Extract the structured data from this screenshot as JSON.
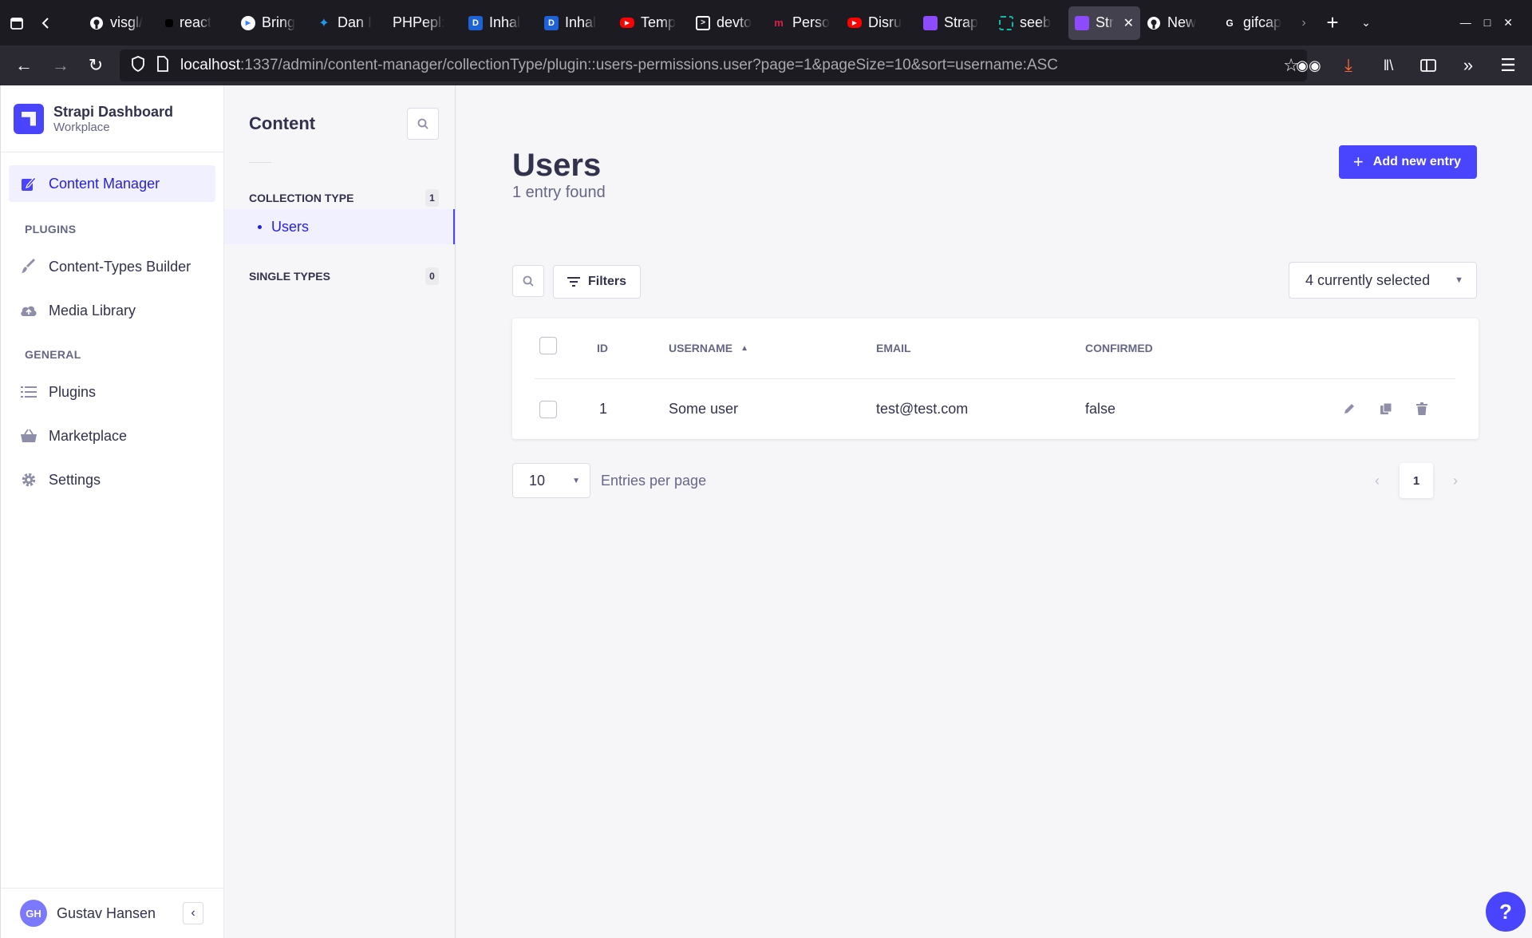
{
  "browser": {
    "tabs": [
      {
        "label": "",
        "color": "#1c1b22"
      },
      {
        "label": "visgl/",
        "color": "#fbfbfe"
      },
      {
        "label": "react",
        "color": "#111111"
      },
      {
        "label": "Bring",
        "color": "#3b82f6"
      },
      {
        "label": "Dan I",
        "color": "#1d9bf0"
      },
      {
        "label": "PHPepl:",
        "color": "#2b2a33"
      },
      {
        "label": "Inhal",
        "color": "#1e63d6"
      },
      {
        "label": "Inhal",
        "color": "#1e63d6"
      },
      {
        "label": "Temp",
        "color": "#ff0000"
      },
      {
        "label": "devto",
        "color": "#2b2a33"
      },
      {
        "label": "Perso",
        "color": "#e11d48"
      },
      {
        "label": "Disru",
        "color": "#ff0000"
      },
      {
        "label": "Strap",
        "color": "#8c4bff"
      },
      {
        "label": "seeb",
        "color": "#14b8a6"
      },
      {
        "label": "Str",
        "color": "#8c4bff",
        "active": true
      },
      {
        "label": "New",
        "color": "#fbfbfe"
      },
      {
        "label": "gifcap",
        "color": "#e11d48"
      }
    ],
    "url_host": "localhost",
    "url_path": ":1337/admin/content-manager/collectionType/plugin::users-permissions.user?page=1&pageSize=10&sort=username:ASC"
  },
  "brand": {
    "title": "Strapi Dashboard",
    "subtitle": "Workplace",
    "color": "#4945ff"
  },
  "mainnav": {
    "content_manager": "Content Manager",
    "plugins_label": "PLUGINS",
    "content_types_builder": "Content-Types Builder",
    "media_library": "Media Library",
    "general_label": "GENERAL",
    "plugins": "Plugins",
    "marketplace": "Marketplace",
    "settings": "Settings"
  },
  "user": {
    "initials": "GH",
    "name": "Gustav Hansen"
  },
  "subnav": {
    "title": "Content",
    "collection_type_label": "COLLECTION TYPE",
    "collection_type_count": "1",
    "users_link": "Users",
    "single_types_label": "SINGLE TYPES",
    "single_types_count": "0"
  },
  "main": {
    "title": "Users",
    "subtitle": "1 entry found",
    "add_button": "Add new entry",
    "filters_button": "Filters",
    "fields_select": "4 currently selected"
  },
  "table": {
    "headers": {
      "id": "ID",
      "username": "USERNAME",
      "email": "EMAIL",
      "confirmed": "CONFIRMED"
    },
    "rows": [
      {
        "id": "1",
        "username": "Some user",
        "email": "test@test.com",
        "confirmed": "false"
      }
    ]
  },
  "pagination": {
    "page_size": "10",
    "per_page_label": "Entries per page",
    "current_page": "1"
  },
  "help": "?"
}
